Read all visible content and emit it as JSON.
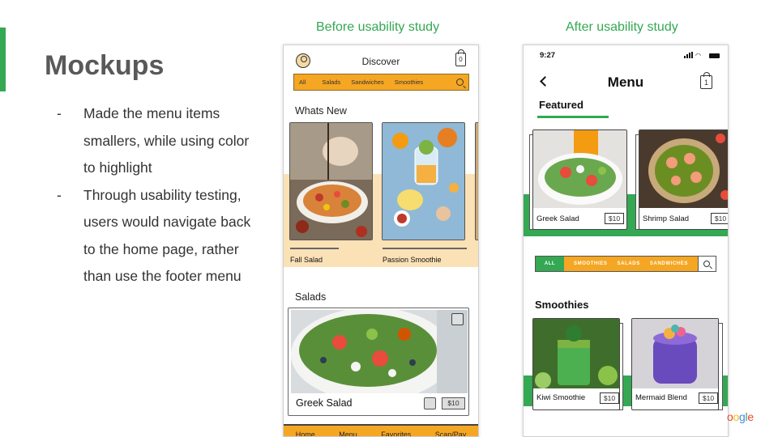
{
  "slide": {
    "title": "Mockups",
    "bullets": [
      {
        "dash": "-",
        "text": "Made the menu items smallers, while using color to highlight"
      },
      {
        "dash": "-",
        "text": "Through usability testing, users would navigate back to the home page, rather than use the footer menu"
      }
    ],
    "label_before": "Before usability study",
    "label_after": "After usability study",
    "logo_text": "ogle"
  },
  "before": {
    "header_title": "Discover",
    "cart_count": "0",
    "nav": [
      "All",
      "Salads",
      "Sandwiches",
      "Smoothies"
    ],
    "whats_new_title": "Whats New",
    "whats_new_items": [
      "Fall Salad",
      "Passion Smoothie"
    ],
    "salads_title": "Salads",
    "salad_card": {
      "name": "Greek Salad",
      "price": "$10"
    },
    "footer": [
      "Home",
      "Menu",
      "Favorites",
      "Scan/Pay"
    ]
  },
  "after": {
    "time": "9:27",
    "title": "Menu",
    "cart_count": "1",
    "featured_title": "Featured",
    "featured_items": [
      {
        "name": "Greek Salad",
        "price": "$10"
      },
      {
        "name": "Shrimp Salad",
        "price": "$10"
      }
    ],
    "filter": [
      "ALL",
      "SMOOTHIES",
      "SALADS",
      "SANDWICHES"
    ],
    "smoothies_title": "Smoothies",
    "smoothie_items": [
      {
        "name": "Kiwi Smoothie",
        "price": "$10"
      },
      {
        "name": "Mermaid Blend",
        "price": "$10"
      }
    ]
  },
  "colors": {
    "accent_green": "#34a853",
    "accent_orange": "#f5a623",
    "band_cream": "#fbe1b6"
  }
}
